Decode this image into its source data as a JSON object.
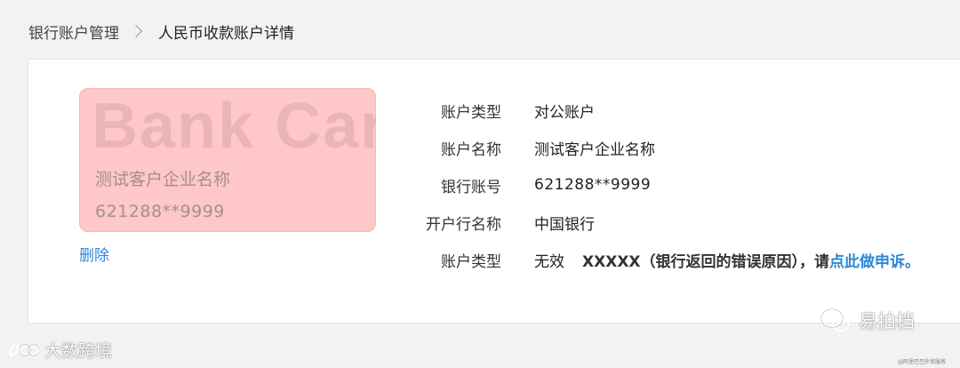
{
  "breadcrumb": {
    "home": "银行账户管理",
    "current": "人民币收款账户详情"
  },
  "card": {
    "watermark": "Bank Card",
    "name": "测试客户企业名称",
    "number": "621288**9999",
    "color": "#ffc7c7"
  },
  "actions": {
    "delete_label": "删除"
  },
  "details": {
    "rows": [
      {
        "label": "账户类型",
        "value": "对公账户"
      },
      {
        "label": "账户名称",
        "value": "测试客户企业名称"
      },
      {
        "label": "银行账号",
        "value": "621288**9999"
      },
      {
        "label": "开户行名称",
        "value": "中国银行"
      }
    ],
    "status_row": {
      "label": "账户类型",
      "status": "无效",
      "reason": "XXXXX（银行返回的错误原因），请",
      "link_text": "点此做申诉。"
    }
  },
  "watermarks": {
    "left": "大数跨境",
    "right": "易拍档",
    "tiny": "@阿里巴巴外贸服务"
  },
  "colors": {
    "link": "#2e86d6",
    "background": "#f2f2f4",
    "panel": "#ffffff"
  }
}
